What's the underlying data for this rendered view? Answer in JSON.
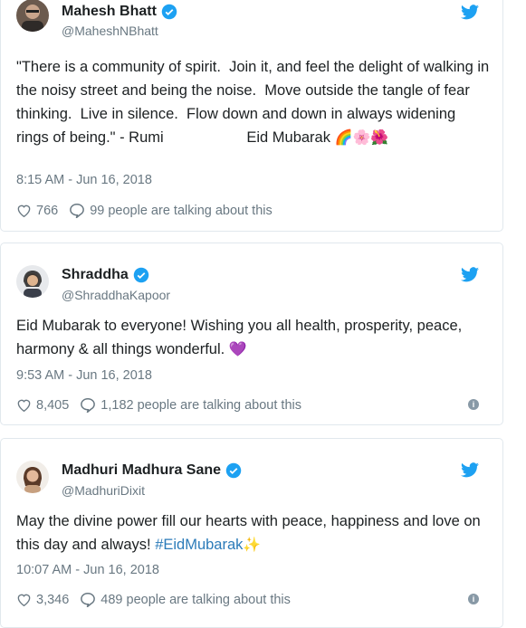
{
  "tweets": [
    {
      "name": "Mahesh Bhatt",
      "handle": "@MaheshNBhatt",
      "text": "\"There is a community of spirit.  Join it, and feel the delight of walking in the noisy street and being the noise.  Move outside the tangle of fear thinking.  Live in silence.  Flow down and down in always widening rings of being.\" - Rumi                    Eid Mubarak",
      "emojis": "🌈🌸🌺",
      "time": "8:15 AM - Jun 16, 2018",
      "likes": "766",
      "talking": "99 people are talking about this"
    },
    {
      "name": "Shraddha",
      "handle": "@ShraddhaKapoor",
      "text": "Eid Mubarak to everyone! Wishing you all health, prosperity, peace, harmony & all things wonderful.",
      "emojis": "💜",
      "time": "9:53 AM - Jun 16, 2018",
      "likes": "8,405",
      "talking": "1,182 people are talking about this"
    },
    {
      "name": "Madhuri Madhura Sane",
      "handle": "@MadhuriDixit",
      "text": "May the divine power fill our hearts with peace, happiness and love on this day and always!",
      "hashtag": "#EidMubarak",
      "emojis": "✨",
      "time": "10:07 AM - Jun 16, 2018",
      "likes": "3,346",
      "talking": "489 people are talking about this"
    }
  ],
  "colors": {
    "twitter_blue": "#1da1f2",
    "text": "#1c2022",
    "muted": "#697882",
    "link": "#2b7bb9"
  }
}
